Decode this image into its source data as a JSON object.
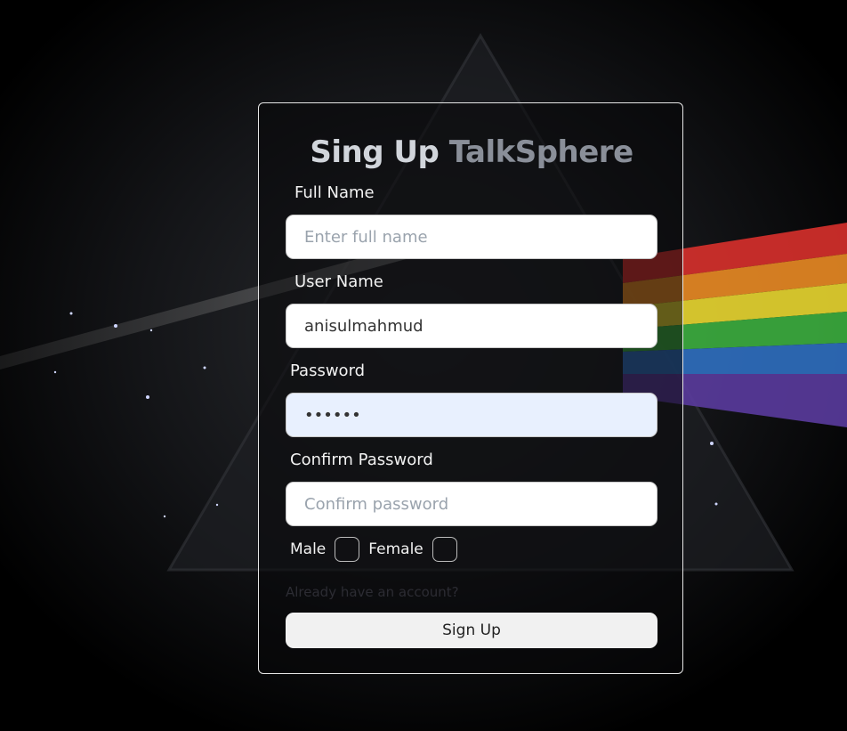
{
  "form": {
    "title_main": "Sing Up",
    "title_brand": "TalkSphere",
    "full_name": {
      "label": "Full Name",
      "value": "",
      "placeholder": "Enter full name"
    },
    "user_name": {
      "label": "User Name",
      "value": "anisulmahmud",
      "placeholder": ""
    },
    "password": {
      "label": "Password",
      "value": "••••••",
      "placeholder": ""
    },
    "confirm_password": {
      "label": "Confirm Password",
      "value": "",
      "placeholder": "Confirm password"
    },
    "gender": {
      "male_label": "Male",
      "female_label": "Female"
    },
    "login_link": "Already have an account?",
    "submit_label": "Sign Up"
  },
  "colors": {
    "brand": "#8a8f99",
    "autofill_bg": "#e8f0fe",
    "button_bg": "#f1f1f1"
  }
}
